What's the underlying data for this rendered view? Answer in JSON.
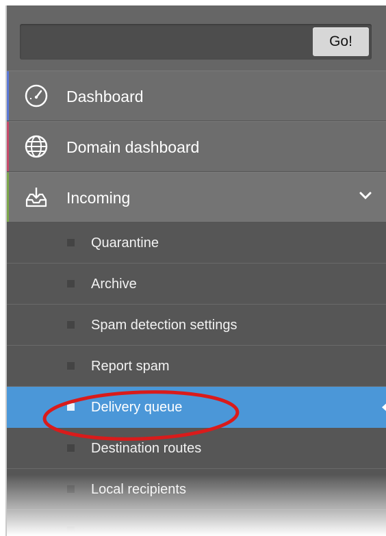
{
  "search": {
    "placeholder": "",
    "go_label": "Go!"
  },
  "menu": {
    "main_items": [
      {
        "label": "Dashboard",
        "icon": "dashboard-gauge-icon",
        "accent_color": "#5b78d6"
      },
      {
        "label": "Domain dashboard",
        "icon": "globe-icon",
        "accent_color": "#c64a6a"
      },
      {
        "label": "Incoming",
        "icon": "inbox-download-icon",
        "accent_color": "#7ca64a",
        "expanded": true
      }
    ],
    "incoming_subitems": [
      {
        "label": "Quarantine"
      },
      {
        "label": "Archive"
      },
      {
        "label": "Spam detection settings"
      },
      {
        "label": "Report spam"
      },
      {
        "label": "Delivery queue",
        "active": true
      },
      {
        "label": "Destination routes"
      },
      {
        "label": "Local recipients"
      }
    ]
  },
  "colors": {
    "active_item": "#4b97d8",
    "annotation_circle": "#d91b1b"
  }
}
